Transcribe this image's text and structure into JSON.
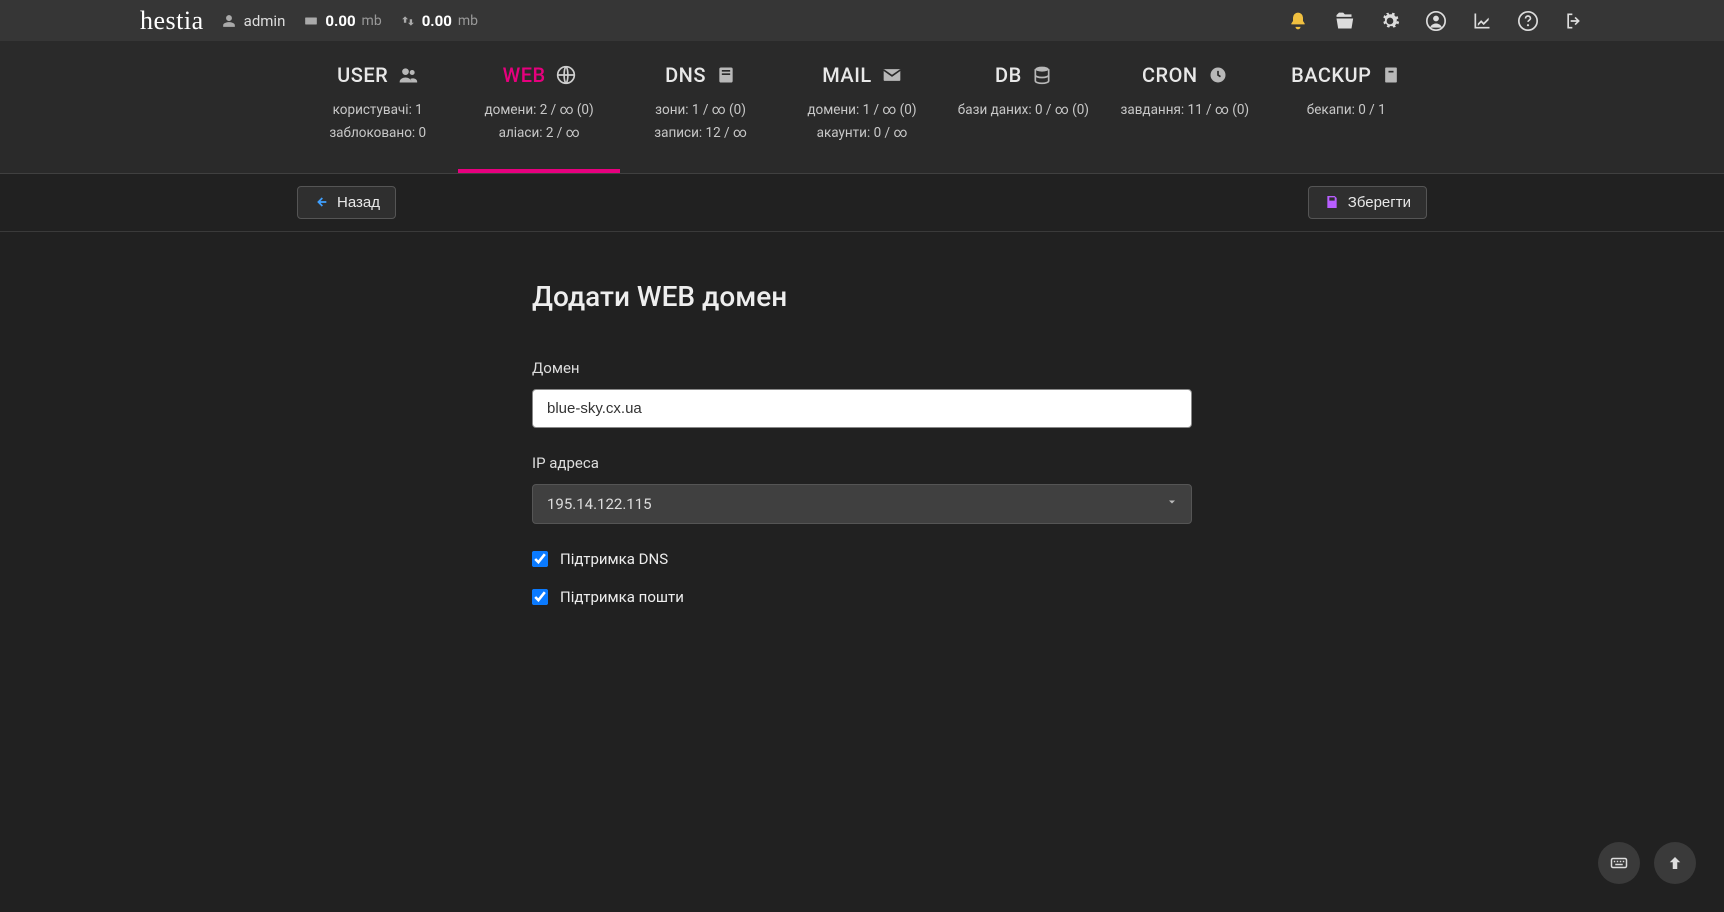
{
  "brand": "hestia",
  "topbar": {
    "user": "admin",
    "disk_value": "0.00",
    "disk_unit": "mb",
    "bw_value": "0.00",
    "bw_unit": "mb"
  },
  "nav": {
    "user": {
      "title": "USER",
      "line1": "користувачі: 1",
      "line2": "заблоковано: 0"
    },
    "web": {
      "title": "WEB",
      "line1": "домени: 2 / ∞ (0)",
      "line2": "аліаси: 2 / ∞"
    },
    "dns": {
      "title": "DNS",
      "line1": "зони: 1 / ∞ (0)",
      "line2": "записи: 12 / ∞"
    },
    "mail": {
      "title": "MAIL",
      "line1": "домени: 1 / ∞ (0)",
      "line2": "акаунти: 0 / ∞"
    },
    "db": {
      "title": "DB",
      "line1": "бази даних: 0 / ∞ (0)",
      "line2": ""
    },
    "cron": {
      "title": "CRON",
      "line1": "завдання: 11 / ∞ (0)",
      "line2": ""
    },
    "backup": {
      "title": "BACKUP",
      "line1": "бекапи: 0 / 1",
      "line2": ""
    }
  },
  "actions": {
    "back": "Назад",
    "save": "Зберегти"
  },
  "form": {
    "title": "Додати WEB домен",
    "domain_label": "Домен",
    "domain_value": "blue-sky.cx.ua",
    "ip_label": "IP адреса",
    "ip_value": "195.14.122.115",
    "dns_support_label": "Підтримка DNS",
    "mail_support_label": "Підтримка пошти"
  }
}
